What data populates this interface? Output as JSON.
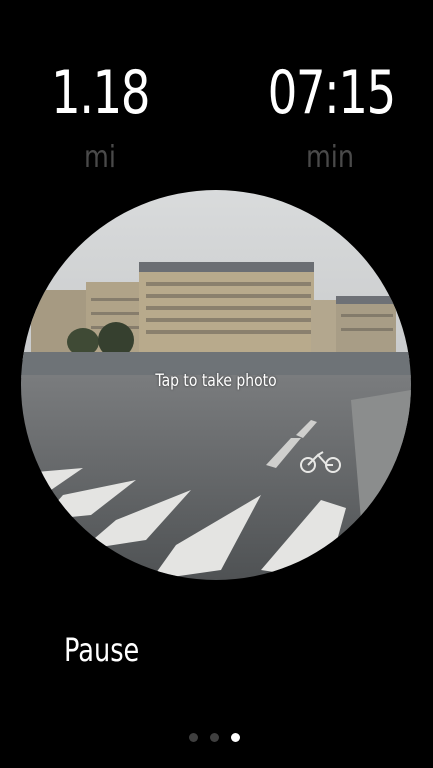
{
  "stats": {
    "distance": {
      "value": "1.18",
      "unit": "mi"
    },
    "time": {
      "value": "07:15",
      "unit": "min"
    }
  },
  "camera": {
    "hint": "Tap to take photo"
  },
  "controls": {
    "pause_label": "Pause"
  },
  "pager": {
    "count": 3,
    "active_index": 2
  },
  "colors": {
    "background": "#000000",
    "primary_text": "#ffffff",
    "unit_text": "#4a4a4a",
    "dot_inactive": "#3f3f3f",
    "dot_active": "#ffffff"
  }
}
